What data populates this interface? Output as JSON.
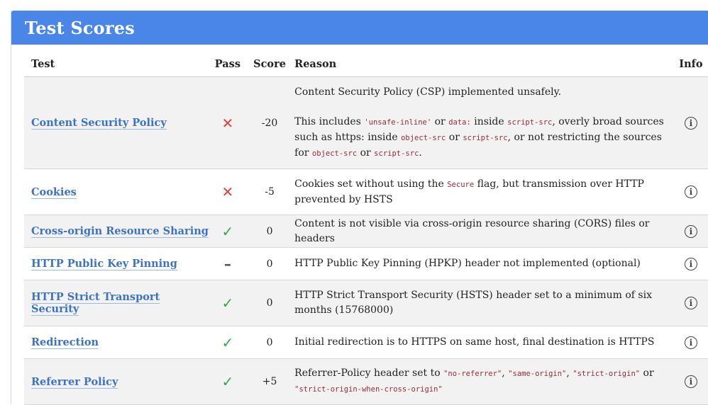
{
  "title": "Test Scores",
  "headers": {
    "test": "Test",
    "pass": "Pass",
    "score": "Score",
    "reason": "Reason",
    "info": "Info"
  },
  "icons": {
    "fail": "✕",
    "pass": "✓",
    "neutral": "–",
    "info": "i"
  },
  "colors": {
    "header_bg": "#4a86e8",
    "link": "#3d73c6",
    "fail": "#e0423b",
    "pass": "#2faa4d",
    "code": "#9b2b3c"
  },
  "rows": [
    {
      "test": "Content Security Policy",
      "status": "fail",
      "score": "-20",
      "reason": {
        "p1": "Content Security Policy (CSP) implemented unsafely.",
        "t1": "This includes ",
        "c1": "'unsafe-inline'",
        "t2": " or ",
        "c2": "data:",
        "t3": " inside ",
        "c3": "script-src",
        "t4": ", overly broad sources such as https: inside ",
        "c4": "object-src",
        "t5": " or ",
        "c5": "script-src",
        "t6": ", or not restricting the sources for ",
        "c6": "object-src",
        "t7": " or ",
        "c7": "script-src",
        "t8": "."
      }
    },
    {
      "test": "Cookies",
      "status": "fail",
      "score": "-5",
      "reason": {
        "t1": "Cookies set without using the ",
        "c1": "Secure",
        "t2": " flag, but transmission over HTTP prevented by HSTS"
      }
    },
    {
      "test": "Cross-origin Resource Sharing",
      "status": "pass",
      "score": "0",
      "reason": {
        "t1": "Content is not visible via cross-origin resource sharing (CORS) files or headers"
      }
    },
    {
      "test": "HTTP Public Key Pinning",
      "status": "neutral",
      "score": "0",
      "reason": {
        "t1": "HTTP Public Key Pinning (HPKP) header not implemented (optional)"
      }
    },
    {
      "test": "HTTP Strict Transport Security",
      "status": "pass",
      "score": "0",
      "reason": {
        "t1": "HTTP Strict Transport Security (HSTS) header set to a minimum of six months (15768000)"
      }
    },
    {
      "test": "Redirection",
      "status": "pass",
      "score": "0",
      "reason": {
        "t1": "Initial redirection is to HTTPS on same host, final destination is HTTPS"
      }
    },
    {
      "test": "Referrer Policy",
      "status": "pass",
      "score": "+5",
      "reason": {
        "t1": "Referrer-Policy header set to ",
        "c1": "\"no-referrer\"",
        "t2": ", ",
        "c2": "\"same-origin\"",
        "t3": ", ",
        "c3": "\"strict-origin\"",
        "t4": " or ",
        "c4": "\"strict-origin-when-cross-origin\""
      }
    }
  ]
}
